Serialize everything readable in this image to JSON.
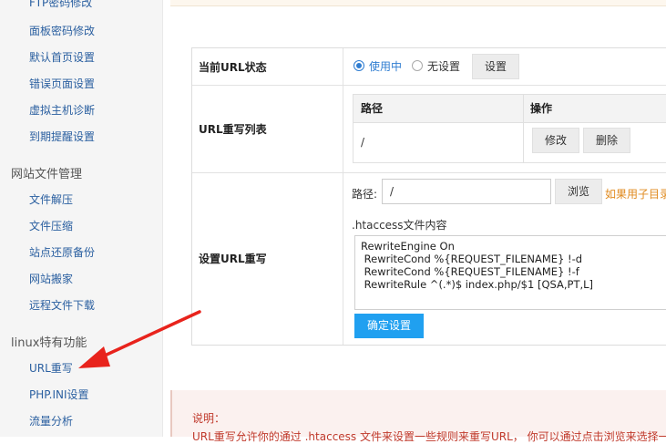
{
  "sidebar": {
    "items": [
      {
        "label": "FTP密码修改"
      },
      {
        "label": "面板密码修改"
      },
      {
        "label": "默认首页设置"
      },
      {
        "label": "错误页面设置"
      },
      {
        "label": "虚拟主机诊断"
      },
      {
        "label": "到期提醒设置"
      }
    ],
    "group_files": {
      "title": "网站文件管理",
      "items": [
        {
          "label": "文件解压"
        },
        {
          "label": "文件压缩"
        },
        {
          "label": "站点还原备份"
        },
        {
          "label": "网站搬家"
        },
        {
          "label": "远程文件下载"
        }
      ]
    },
    "group_linux": {
      "title": "linux特有功能",
      "items": [
        {
          "label": "URL重写"
        },
        {
          "label": "PHP.INI设置"
        },
        {
          "label": "流量分析"
        }
      ]
    }
  },
  "url_status": {
    "label": "当前URL状态",
    "option_on": "使用中",
    "option_off": "无设置",
    "selected": "使用中",
    "set_button": "设置"
  },
  "rewrite_list": {
    "label": "URL重写列表",
    "col_path": "路径",
    "col_action": "操作",
    "rows": [
      {
        "path": "/",
        "edit": "修改",
        "delete": "删除"
      }
    ]
  },
  "set_rewrite": {
    "label": "设置URL重写",
    "path_label": "路径:",
    "path_value": "/",
    "browse_button": "浏览",
    "hint": "如果用子目录",
    "htaccess_label": ".htaccess文件内容",
    "htaccess_content": "RewriteEngine On\n RewriteCond %{REQUEST_FILENAME} !-d\n RewriteCond %{REQUEST_FILENAME} !-f\n RewriteRule ^(.*)$ index.php/$1 [QSA,PT,L]",
    "confirm_button": "确定设置"
  },
  "note": {
    "title": "说明：",
    "text": "URL重写允许你的通过 .htaccess 文件来设置一些规则来重写URL， 你可以通过点击浏览来选择一个"
  },
  "colors": {
    "link": "#2a5fa0",
    "primary_button": "#20a0f0",
    "hint": "#e08a1e",
    "note_text": "#c0392b",
    "arrow": "#e8231c"
  }
}
